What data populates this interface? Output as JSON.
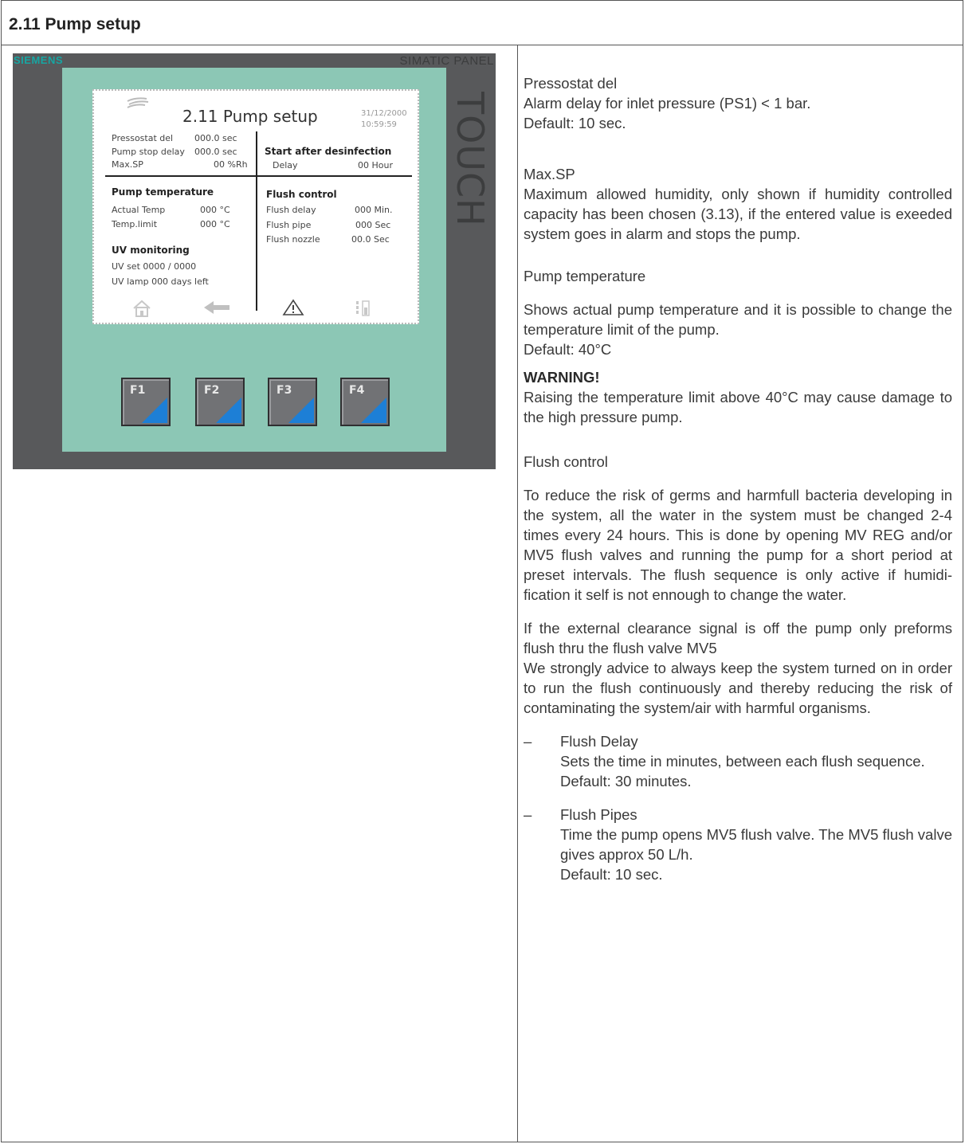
{
  "header": {
    "title": "2.11 Pump setup"
  },
  "panel": {
    "brand": "SIEMENS",
    "model": "SIMATIC PANEL",
    "touch": "TOUCH",
    "screen": {
      "title": "2.11 Pump setup",
      "date": "31/12/2000",
      "time": "10:59:59",
      "left_rows": [
        {
          "label": "Pressostat del",
          "value": "000.0 sec"
        },
        {
          "label": "Pump stop delay",
          "value": "000.0 sec"
        },
        {
          "label": "Max.SP",
          "value": "00 %Rh"
        }
      ],
      "start_heading": "Start after desinfection",
      "start_label": "Delay",
      "start_value": "00 Hour",
      "pump_temp_heading": "Pump temperature",
      "temp_rows": [
        {
          "label": "Actual Temp",
          "value": "000 °C"
        },
        {
          "label": "Temp.limit",
          "value": "000 °C"
        }
      ],
      "uv_heading": "UV monitoring",
      "uv_set": "UV set  0000  /  0000",
      "uv_lamp": "UV lamp   000  days left",
      "flush_heading": "Flush control",
      "flush_rows": [
        {
          "label": "Flush delay",
          "value": "000 Min."
        },
        {
          "label": "Flush pipe",
          "value": "000 Sec"
        },
        {
          "label": "Flush nozzle",
          "value": "00.0 Sec"
        }
      ],
      "nav_icons": [
        "home-icon",
        "back-arrow-icon",
        "alarm-warning-icon",
        "settings-slider-icon"
      ]
    },
    "function_keys": [
      "F1",
      "F2",
      "F3",
      "F4"
    ],
    "colors": {
      "housing": "#58595b",
      "bezel": "#8cc7b5",
      "brand": "#17a6a3",
      "key_accent": "#1d7fd6"
    }
  },
  "text": {
    "pressostat_title": "Pressostat del",
    "pressostat_desc": "Alarm delay for inlet pressure (PS1) < 1 bar.",
    "pressostat_default": "Default: 10 sec.",
    "maxsp_title": "Max.SP",
    "maxsp_desc": "Maximum allowed humidity, only shown if humidity controlled capacity has been chosen (3.13), if the entered value is exeeded system goes in alarm and stops the pump.",
    "pump_temp_title": "Pump temperature",
    "pump_temp_desc": "Shows actual pump temperature and it is possible to change the temperature limit of the pump.",
    "pump_temp_default": "Default: 40°C",
    "warning_title": "WARNING!",
    "warning_desc": "Raising the temperature limit above 40°C may cause damage to the high pressure pump.",
    "flush_title": "Flush control",
    "flush_desc": "To reduce the risk of germs and harmfull bacteria developing in the system, all the water in the system must be changed 2-4 times every 24 hours. This is done by opening MV REG  and/or MV5 flush valves and running the pump for a short period at preset intervals. The flush sequence is only active if humidi­fication it self is not ennough to change the water.",
    "clearance_desc": "If the external clearance signal is off the pump only preforms flush thru the flush valve MV5",
    "advice_desc": "We strongly advice to always keep the system turned on in order to run the flush continuously and thereby reducing the risk of contaminating the system/air with harmful organisms.",
    "bullets": [
      {
        "dash": "–",
        "title": "Flush Delay",
        "desc": "Sets the time in minutes, between each flush sequence.",
        "default": "Default: 30 minutes."
      },
      {
        "dash": "–",
        "title": "Flush Pipes",
        "desc": "Time the pump opens MV5 flush valve. The MV5 flush valve gives approx 50 L/h.",
        "default": "Default: 10 sec."
      }
    ]
  }
}
